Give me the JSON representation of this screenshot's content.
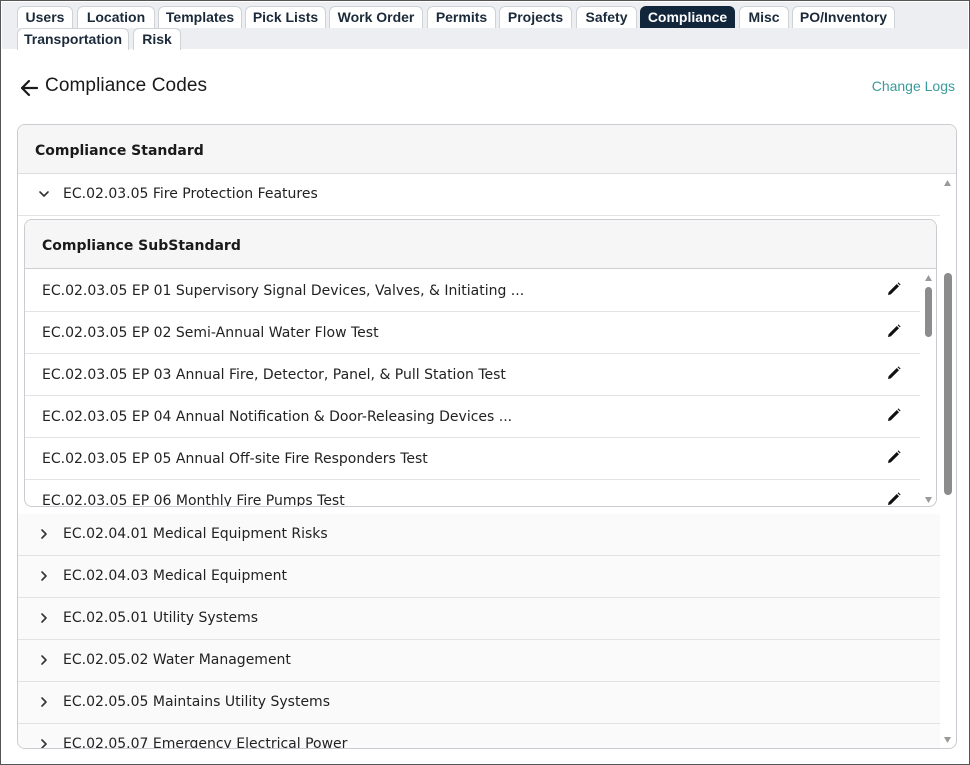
{
  "tabs": [
    {
      "label": "Users",
      "active": false
    },
    {
      "label": "Location",
      "active": false
    },
    {
      "label": "Templates",
      "active": false
    },
    {
      "label": "Pick Lists",
      "active": false
    },
    {
      "label": "Work Order",
      "active": false
    },
    {
      "label": "Permits",
      "active": false
    },
    {
      "label": "Projects",
      "active": false
    },
    {
      "label": "Safety",
      "active": false
    },
    {
      "label": "Compliance",
      "active": true
    },
    {
      "label": "Misc",
      "active": false
    },
    {
      "label": "PO/Inventory",
      "active": false
    },
    {
      "label": "Transportation",
      "active": false
    },
    {
      "label": "Risk",
      "active": false
    }
  ],
  "header": {
    "back_icon": "arrow-left-icon",
    "title": "Compliance Codes",
    "change_logs": "Change Logs"
  },
  "standards": {
    "column_header": "Compliance Standard",
    "expanded": {
      "label": "EC.02.03.05 Fire Protection Features",
      "sub_header": "Compliance SubStandard",
      "items": [
        "EC.02.03.05 EP 01 Supervisory Signal Devices, Valves, & Initiating ...",
        "EC.02.03.05 EP 02 Semi-Annual Water Flow Test",
        "EC.02.03.05 EP 03 Annual Fire, Detector, Panel, & Pull Station Test",
        "EC.02.03.05 EP 04 Annual Notification & Door-Releasing Devices ...",
        "EC.02.03.05 EP 05 Annual Off-site Fire Responders Test",
        "EC.02.03.05 EP 06 Monthly Fire Pumps Test"
      ]
    },
    "collapsed": [
      "EC.02.04.01 Medical Equipment Risks",
      "EC.02.04.03 Medical Equipment",
      "EC.02.05.01 Utility Systems",
      "EC.02.05.02 Water Management",
      "EC.02.05.05 Maintains Utility Systems",
      "EC.02.05.07 Emergency Electrical Power"
    ]
  },
  "colors": {
    "active_tab": "#11263b",
    "link": "#3a9b9a"
  }
}
